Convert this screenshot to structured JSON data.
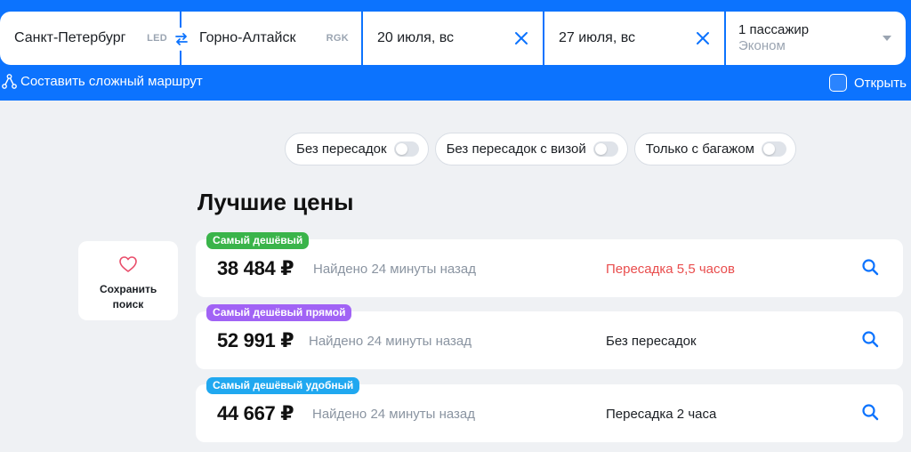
{
  "search": {
    "origin": {
      "city": "Санкт-Петербург",
      "iata": "LED"
    },
    "destination": {
      "city": "Горно-Алтайск",
      "iata": "RGK"
    },
    "depart_date": "20 июля, вс",
    "return_date": "27 июля, вс",
    "passengers": "1 пассажир",
    "cabin_class": "Эконом",
    "complex_route_label": "Составить сложный маршрут",
    "open_label": "Открыть"
  },
  "filters": [
    {
      "label": "Без пересадок",
      "enabled": false
    },
    {
      "label": "Без пересадок с визой",
      "enabled": false
    },
    {
      "label": "Только с багажом",
      "enabled": false
    }
  ],
  "best_prices": {
    "title": "Лучшие цены",
    "save_search_label": "Сохранить поиск",
    "cards": [
      {
        "badge": "Самый дешёвый",
        "badge_color": "#3ab44a",
        "price": "38 484 ₽",
        "found": "Найдено 24 минуты назад",
        "transfer": "Пересадка 5,5 часов",
        "transfer_color": "#e94d4d"
      },
      {
        "badge": "Самый дешёвый прямой",
        "badge_color": "#a163f5",
        "price": "52 991 ₽",
        "found": "Найдено 24 минуты назад",
        "transfer": "Без пересадок",
        "transfer_color": "#1b1f24"
      },
      {
        "badge": "Самый дешёвый удобный",
        "badge_color": "#20a8f0",
        "price": "44 667 ₽",
        "found": "Найдено 24 минуты назад",
        "transfer": "Пересадка 2 часа",
        "transfer_color": "#1b1f24"
      }
    ]
  },
  "colors": {
    "brand": "#0c73fe",
    "accent_icon": "#0c73fe",
    "heart": "#e94d6a"
  },
  "icons": [
    "swap-icon",
    "clear-icon",
    "chevron-down-icon",
    "route-icon",
    "heart-icon",
    "search-icon"
  ]
}
